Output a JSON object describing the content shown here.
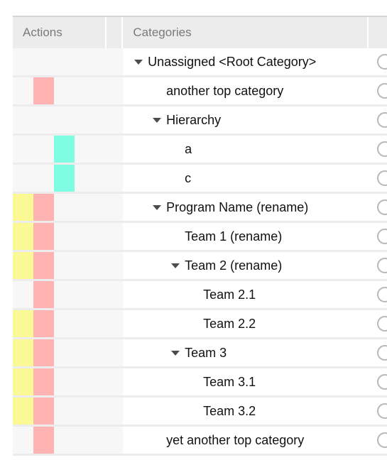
{
  "table": {
    "columns": [
      {
        "key": "actions",
        "label": "Actions"
      },
      {
        "key": "spacer",
        "label": ""
      },
      {
        "key": "categories",
        "label": "Categories"
      },
      {
        "key": "tail",
        "label": ""
      }
    ],
    "colors": {
      "pink": "#ffb3b3",
      "turquoise": "#7ffde3",
      "yellow": "#fbf896",
      "header_bg": "#ececec",
      "header_text": "#7a7a7a",
      "row_bg": "#ffffff",
      "actions_bg": "#f7f7f7",
      "row_separator": "#ececec",
      "label_text": "#111111",
      "caret": "#4c4c4c",
      "circle_border": "#b8b8b8"
    },
    "rows": [
      {
        "label": "Unassigned <Root Category>",
        "indent": 0,
        "expandable": true,
        "swatches": [
          "none",
          "none",
          "none"
        ],
        "has_circle": true
      },
      {
        "label": "another top category",
        "indent": 1,
        "expandable": false,
        "swatches": [
          "none",
          "pink",
          "none"
        ],
        "has_circle": true
      },
      {
        "label": "Hierarchy",
        "indent": 1,
        "expandable": true,
        "swatches": [
          "none",
          "none",
          "none"
        ],
        "has_circle": true
      },
      {
        "label": "a",
        "indent": 2,
        "expandable": false,
        "swatches": [
          "none",
          "none",
          "turquoise"
        ],
        "has_circle": true
      },
      {
        "label": "c",
        "indent": 2,
        "expandable": false,
        "swatches": [
          "none",
          "none",
          "turquoise"
        ],
        "has_circle": true
      },
      {
        "label": "Program Name (rename)",
        "indent": 1,
        "expandable": true,
        "swatches": [
          "yellow",
          "pink",
          "none"
        ],
        "has_circle": true
      },
      {
        "label": "Team 1 (rename)",
        "indent": 2,
        "expandable": false,
        "swatches": [
          "yellow",
          "pink",
          "none"
        ],
        "has_circle": true
      },
      {
        "label": "Team 2 (rename)",
        "indent": 2,
        "expandable": true,
        "swatches": [
          "yellow",
          "pink",
          "none"
        ],
        "has_circle": true
      },
      {
        "label": "Team 2.1",
        "indent": 3,
        "expandable": false,
        "swatches": [
          "none",
          "pink",
          "none"
        ],
        "has_circle": true
      },
      {
        "label": "Team 2.2",
        "indent": 3,
        "expandable": false,
        "swatches": [
          "yellow",
          "pink",
          "none"
        ],
        "has_circle": true
      },
      {
        "label": "Team 3",
        "indent": 2,
        "expandable": true,
        "swatches": [
          "yellow",
          "pink",
          "none"
        ],
        "has_circle": true
      },
      {
        "label": "Team 3.1",
        "indent": 3,
        "expandable": false,
        "swatches": [
          "yellow",
          "pink",
          "none"
        ],
        "has_circle": true
      },
      {
        "label": "Team 3.2",
        "indent": 3,
        "expandable": false,
        "swatches": [
          "yellow",
          "pink",
          "none"
        ],
        "has_circle": true
      },
      {
        "label": "yet another top category",
        "indent": 1,
        "expandable": false,
        "swatches": [
          "none",
          "pink",
          "none"
        ],
        "has_circle": true
      }
    ]
  }
}
